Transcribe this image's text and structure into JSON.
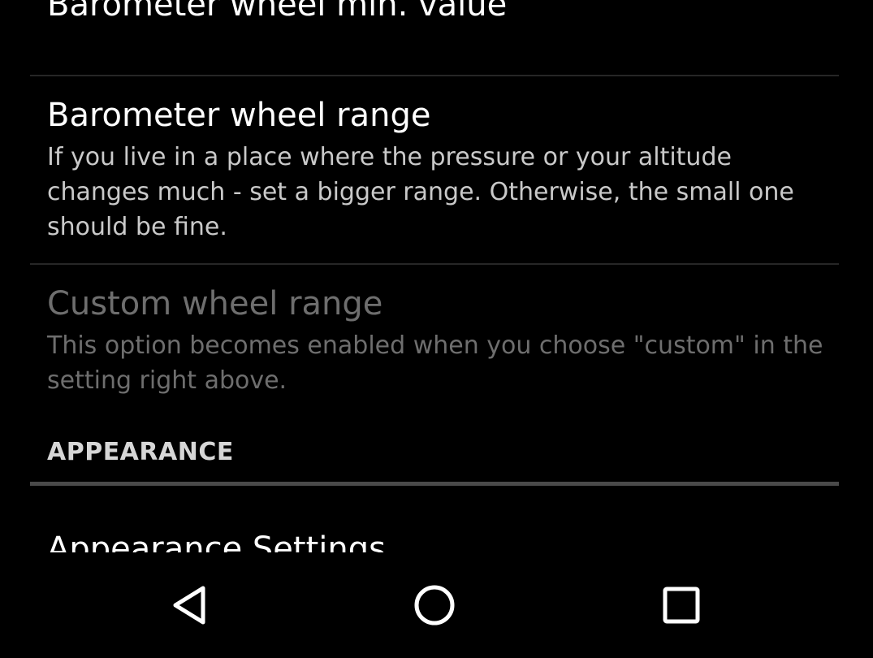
{
  "prefs": {
    "min_value": {
      "title": "Barometer wheel min. value"
    },
    "wheel_range": {
      "title": "Barometer wheel range",
      "summary": "If you live in a place where the pressure or your altitude changes much - set a bigger range. Otherwise, the small one should be fine."
    },
    "custom_range": {
      "title": "Custom wheel range",
      "summary": "This option becomes enabled when you choose \"custom\" in the setting right above.",
      "enabled": false
    },
    "appearance_settings": {
      "title": "Appearance Settings"
    }
  },
  "categories": {
    "appearance": "APPEARANCE"
  },
  "navigation": {
    "back": "back-icon",
    "home": "home-icon",
    "recents": "recents-icon"
  },
  "colors": {
    "background": "#000000",
    "title": "#ffffff",
    "summary": "#c9c9c9",
    "disabled": "#6e6e6e",
    "category_line": "#4a4a4a"
  }
}
